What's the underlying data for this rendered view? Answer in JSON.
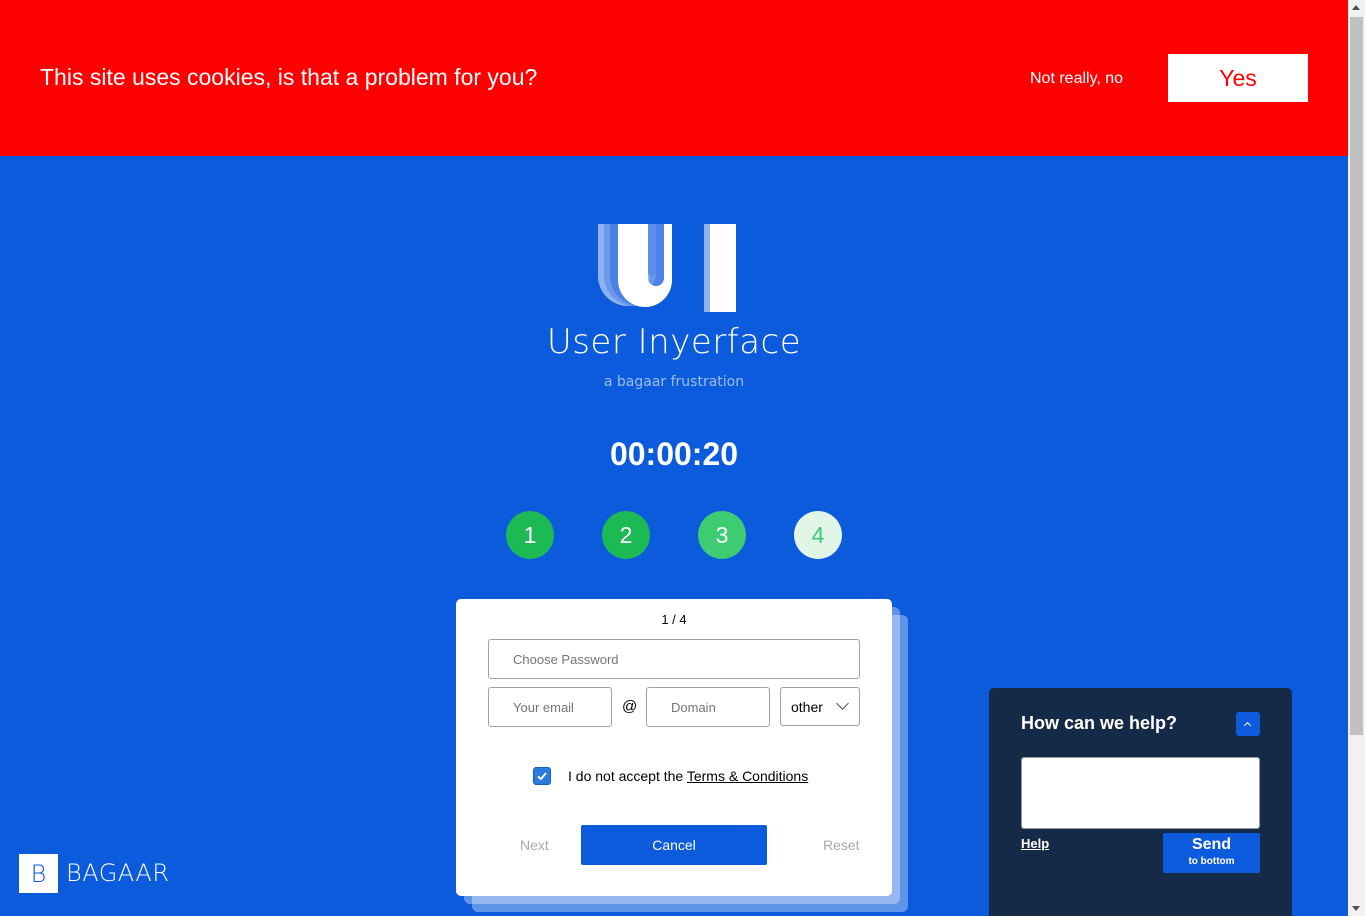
{
  "cookie": {
    "message": "This site uses cookies, is that a problem for you?",
    "decline_label": "Not really, no",
    "accept_label": "Yes"
  },
  "app": {
    "logo_text": "UI",
    "title": "User Inyerface",
    "subtitle": "a bagaar frustration"
  },
  "timer": "00:00:20",
  "steps": [
    {
      "label": "1",
      "color": "#1db954"
    },
    {
      "label": "2",
      "color": "#1db954"
    },
    {
      "label": "3",
      "color": "#3dcc72"
    },
    {
      "label": "4",
      "color": "#e2f6e8",
      "text_color": "#3dcc72"
    }
  ],
  "form": {
    "page_indicator": "1 / 4",
    "password_placeholder": "Choose Password",
    "email_placeholder": "Your email",
    "at_sign": "@",
    "domain_placeholder": "Domain",
    "tld_selected": "other",
    "terms_checked": true,
    "terms_prefix": "I do not accept the ",
    "terms_link": "Terms & Conditions",
    "next_label": "Next",
    "cancel_label": "Cancel",
    "reset_label": "Reset"
  },
  "brand": {
    "initial": "B",
    "name": "BAGAAR"
  },
  "help": {
    "title": "How can we help?",
    "help_link": "Help",
    "send_label": "Send",
    "send_sublabel": "to bottom"
  },
  "colors": {
    "background": "#0c5bdd",
    "cookie_banner": "#ff0000",
    "help_panel": "#142a47"
  }
}
